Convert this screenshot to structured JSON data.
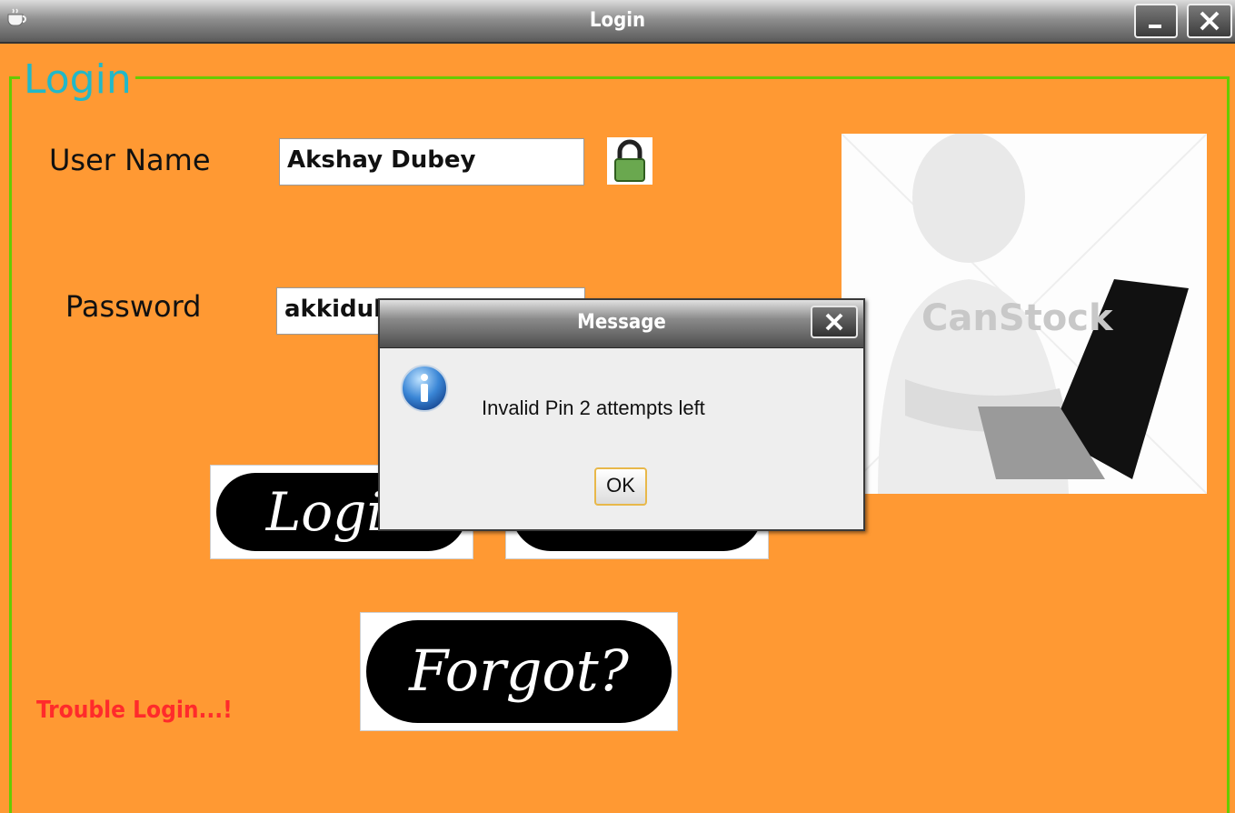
{
  "window": {
    "title": "Login",
    "icon": "coffee-cup-icon"
  },
  "form": {
    "group_title": "Login",
    "username_label": "User Name",
    "username_value": "Akshay Dubey",
    "password_label": "Password",
    "password_value": "akkidub",
    "lock_icon": "lock-icon",
    "photo_watermark": "CanStock",
    "login_button": "Login",
    "signup_button": "",
    "forgot_button": "Forgot?",
    "trouble_text": "Trouble Login...!"
  },
  "dialog": {
    "title": "Message",
    "message": "Invalid Pin 2 attempts left",
    "ok_label": "OK",
    "icon": "info-icon"
  },
  "colors": {
    "background": "#ff9933",
    "group_border": "#66cc00",
    "group_title": "#22b8c8",
    "trouble_text": "#ff2b2b"
  }
}
